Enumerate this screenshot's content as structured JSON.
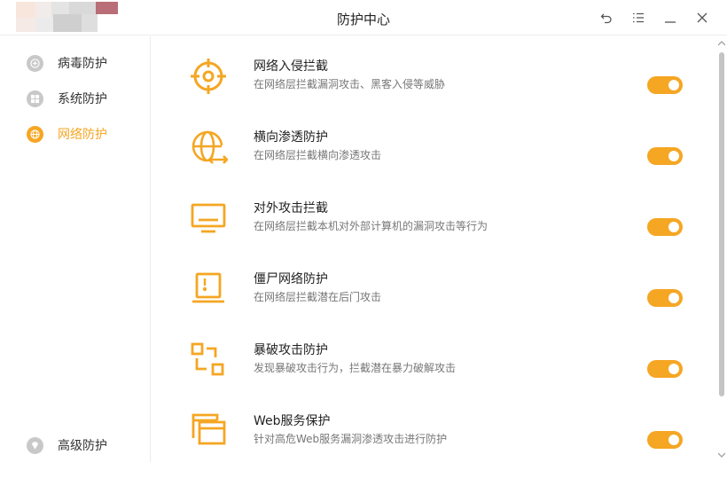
{
  "window": {
    "title": "防护中心"
  },
  "colors": {
    "accent": "#f5a623",
    "inactive_icon": "#c8c8c8"
  },
  "titlebar_buttons": [
    {
      "name": "back-icon"
    },
    {
      "name": "menu-icon"
    },
    {
      "name": "minimize-icon"
    },
    {
      "name": "close-icon"
    }
  ],
  "sidebar": {
    "items": [
      {
        "label": "病毒防护",
        "icon": "plus-icon",
        "active": false
      },
      {
        "label": "系统防护",
        "icon": "windows-icon",
        "active": false
      },
      {
        "label": "网络防护",
        "icon": "globe-icon",
        "active": true
      }
    ],
    "bottom_item": {
      "label": "高级防护",
      "icon": "diamond-icon",
      "active": false
    }
  },
  "protections": [
    {
      "title": "网络入侵拦截",
      "description": "在网络层拦截漏洞攻击、黑客入侵等威胁",
      "icon": "crosshair-icon",
      "enabled": true
    },
    {
      "title": "横向渗透防护",
      "description": "在网络层拦截横向渗透攻击",
      "icon": "globe-arrows-icon",
      "enabled": true
    },
    {
      "title": "对外攻击拦截",
      "description": "在网络层拦截本机对外部计算机的漏洞攻击等行为",
      "icon": "monitor-icon",
      "enabled": true
    },
    {
      "title": "僵尸网络防护",
      "description": "在网络层拦截潜在后门攻击",
      "icon": "laptop-alert-icon",
      "enabled": true
    },
    {
      "title": "暴破攻击防护",
      "description": "发现暴破攻击行为，拦截潜在暴力破解攻击",
      "icon": "brute-force-icon",
      "enabled": true
    },
    {
      "title": "Web服务保护",
      "description": "针对高危Web服务漏洞渗透攻击进行防护",
      "icon": "web-window-icon",
      "enabled": true
    }
  ]
}
